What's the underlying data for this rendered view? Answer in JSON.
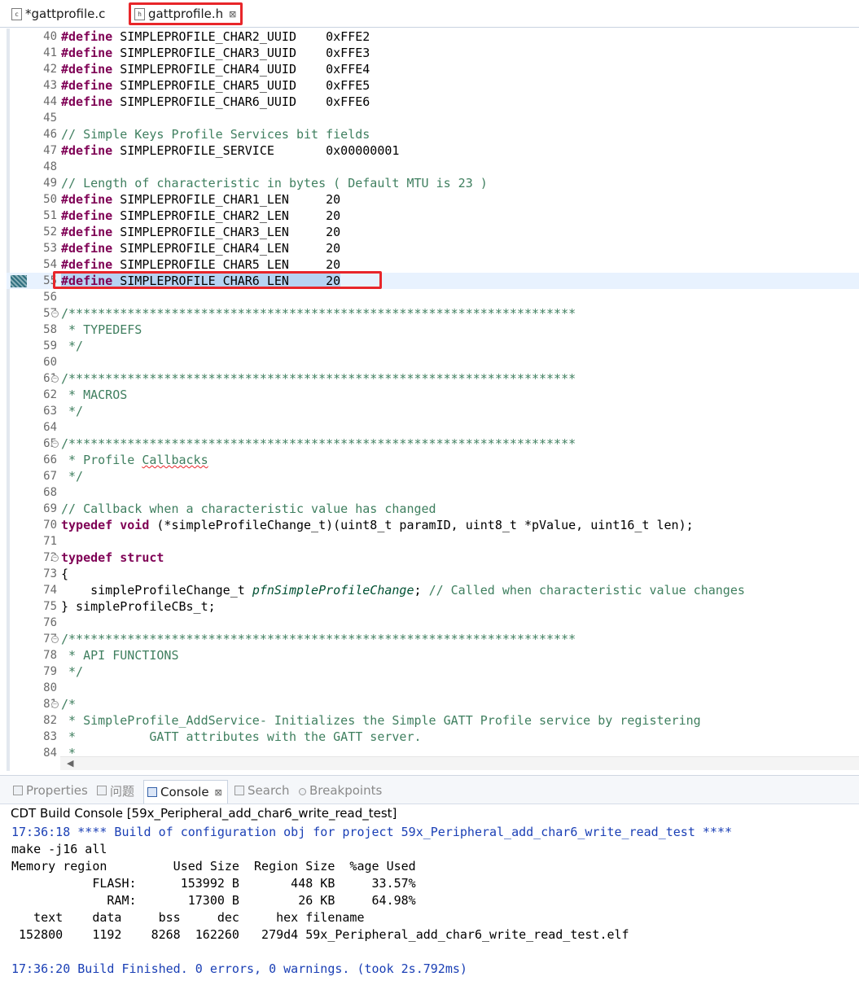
{
  "editor_tabs": [
    {
      "label": "*gattprofile.c",
      "icon": "c-file-icon",
      "active": false
    },
    {
      "label": "gattprofile.h",
      "icon": "h-file-icon",
      "active": true,
      "close": "⊠"
    }
  ],
  "editor": {
    "lines": [
      {
        "num": "40",
        "name": "SIMPLEPROFILE_CHAR2_UUID",
        "val": "0xFFE2"
      },
      {
        "num": "41",
        "name": "SIMPLEPROFILE_CHAR3_UUID",
        "val": "0xFFE3"
      },
      {
        "num": "42",
        "name": "SIMPLEPROFILE_CHAR4_UUID",
        "val": "0xFFE4"
      },
      {
        "num": "43",
        "name": "SIMPLEPROFILE_CHAR5_UUID",
        "val": "0xFFE5"
      },
      {
        "num": "44",
        "name": "SIMPLEPROFILE_CHAR6_UUID",
        "val": "0xFFE6"
      },
      {
        "num": "45"
      },
      {
        "num": "46",
        "comment": "// Simple Keys Profile Services bit fields"
      },
      {
        "num": "47",
        "name": "SIMPLEPROFILE_SERVICE",
        "val": "0x00000001"
      },
      {
        "num": "48"
      },
      {
        "num": "49",
        "comment": "// Length of characteristic in bytes ( Default MTU is 23 )"
      },
      {
        "num": "50",
        "name": "SIMPLEPROFILE_CHAR1_LEN",
        "val": "20"
      },
      {
        "num": "51",
        "name": "SIMPLEPROFILE_CHAR2_LEN",
        "val": "20"
      },
      {
        "num": "52",
        "name": "SIMPLEPROFILE_CHAR3_LEN",
        "val": "20"
      },
      {
        "num": "53",
        "name": "SIMPLEPROFILE_CHAR4_LEN",
        "val": "20"
      },
      {
        "num": "54",
        "name": "SIMPLEPROFILE_CHAR5_LEN",
        "val": "20"
      },
      {
        "num": "55",
        "name": "SIMPLEPROFILE_CHAR6_LEN",
        "val": "20",
        "current": true
      },
      {
        "num": "56"
      },
      {
        "num": "57",
        "fold": true,
        "comment": "/*********************************************************************"
      },
      {
        "num": "58",
        "comment": " * TYPEDEFS"
      },
      {
        "num": "59",
        "comment": " */"
      },
      {
        "num": "60"
      },
      {
        "num": "61",
        "fold": true,
        "comment": "/*********************************************************************"
      },
      {
        "num": "62",
        "comment": " * MACROS"
      },
      {
        "num": "63",
        "comment": " */"
      },
      {
        "num": "64"
      },
      {
        "num": "65",
        "fold": true,
        "comment": "/*********************************************************************"
      },
      {
        "num": "66",
        "comment_pre": " * Profile ",
        "comment_wavy": "Callbacks"
      },
      {
        "num": "67",
        "comment": " */"
      },
      {
        "num": "68"
      },
      {
        "num": "69",
        "comment": "// Callback when a characteristic value has changed"
      },
      {
        "num": "70",
        "kw": "typedef void",
        "text": " (*simpleProfileChange_t)(uint8_t paramID, uint8_t *pValue, uint16_t len);"
      },
      {
        "num": "71"
      },
      {
        "num": "72",
        "fold": true,
        "kw": "typedef struct"
      },
      {
        "num": "73",
        "text": "{"
      },
      {
        "num": "74",
        "text": "    simpleProfileChange_t ",
        "italic": "pfnSimpleProfileChange",
        "text2": "; ",
        "comment": "// Called when characteristic value changes"
      },
      {
        "num": "75",
        "text": "} simpleProfileCBs_t;"
      },
      {
        "num": "76"
      },
      {
        "num": "77",
        "fold": true,
        "comment": "/*********************************************************************"
      },
      {
        "num": "78",
        "comment": " * API FUNCTIONS"
      },
      {
        "num": "79",
        "comment": " */"
      },
      {
        "num": "80"
      },
      {
        "num": "81",
        "fold": true,
        "comment": "/*"
      },
      {
        "num": "82",
        "comment": " * SimpleProfile_AddService- Initializes the Simple GATT Profile service by registering"
      },
      {
        "num": "83",
        "comment": " *          GATT attributes with the GATT server."
      },
      {
        "num": "84",
        "comment": " *"
      }
    ],
    "define_kw": "#define"
  },
  "panel_tabs": [
    {
      "label": "Properties",
      "icon": "properties-icon"
    },
    {
      "label": "问题",
      "icon": "problems-icon"
    },
    {
      "label": "Console",
      "icon": "console-icon",
      "active": true,
      "close": "⊠"
    },
    {
      "label": "Search",
      "icon": "search-icon"
    },
    {
      "label": "Breakpoints",
      "icon": "breakpoints-icon"
    }
  ],
  "console": {
    "title": "CDT Build Console [59x_Peripheral_add_char6_write_read_test]",
    "lines": [
      {
        "text": "17:36:18 **** Build of configuration obj for project 59x_Peripheral_add_char6_write_read_test ****",
        "color": "blue"
      },
      {
        "text": "make -j16 all"
      },
      {
        "text": "Memory region         Used Size  Region Size  %age Used"
      },
      {
        "text": "           FLASH:      153992 B       448 KB     33.57%"
      },
      {
        "text": "             RAM:       17300 B        26 KB     64.98%"
      },
      {
        "text": "   text    data     bss     dec     hex filename"
      },
      {
        "text": " 152800    1192    8268  162260   279d4 59x_Peripheral_add_char6_write_read_test.elf"
      },
      {
        "text": ""
      },
      {
        "text": "17:36:20 Build Finished. 0 errors, 0 warnings. (took 2s.792ms)",
        "color": "blue"
      }
    ]
  }
}
